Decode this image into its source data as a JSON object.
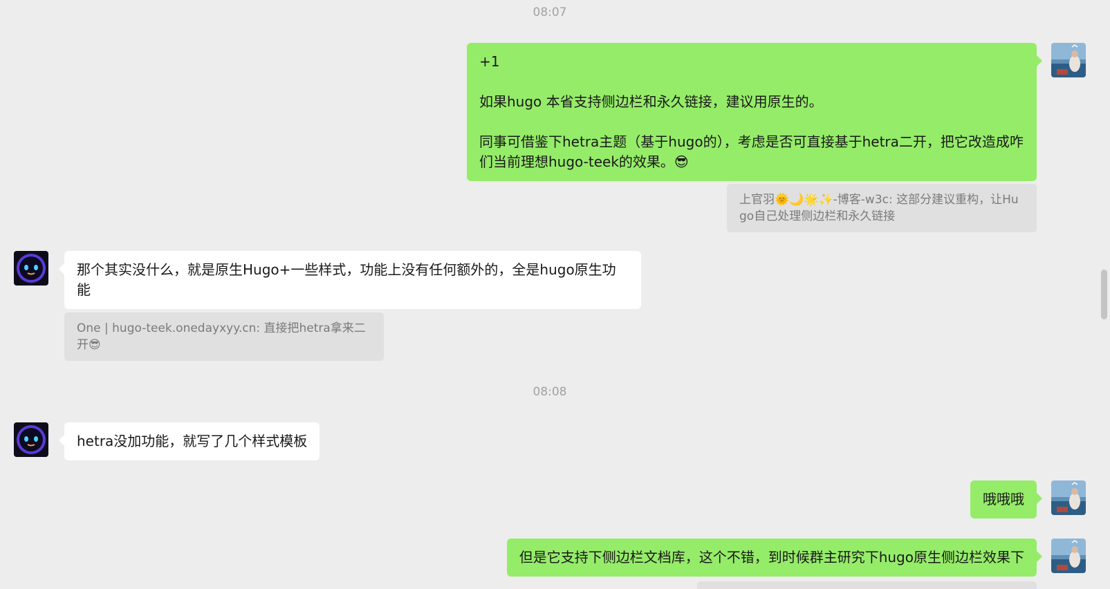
{
  "timestamps": [
    "08:07",
    "08:08"
  ],
  "messages": {
    "m1": "+1\n\n如果hugo 本省支持侧边栏和永久链接，建议用原生的。\n\n同事可借鉴下hetra主题（基于hugo的），考虑是否可直接基于hetra二开，把它改造成咋们当前理想hugo-teek的效果。😎",
    "m1_quote": "上官羽🌞🌙🌟✨-博客-w3c: 这部分建议重构，让Hugo自己处理侧边栏和永久链接",
    "m2": "那个其实没什么，就是原生Hugo+一些样式，功能上没有任何额外的，全是hugo原生功能",
    "m2_quote": "One | hugo-teek.onedayxyy.cn: 直接把hetra拿来二开😎",
    "m3": "hetra没加功能，就写了几个样式模板",
    "m4": "哦哦哦",
    "m5": "但是它支持下侧边栏文档库，这个不错，到时候群主研究下hugo原生侧边栏效果下"
  },
  "colors": {
    "background": "#ededed",
    "my_bubble": "#95ec69",
    "other_bubble": "#ffffff",
    "quote_bg": "#e0e0e0"
  },
  "icons": {
    "my_avatar": "seascape-photo-avatar",
    "other_avatar": "robot-face-avatar"
  }
}
